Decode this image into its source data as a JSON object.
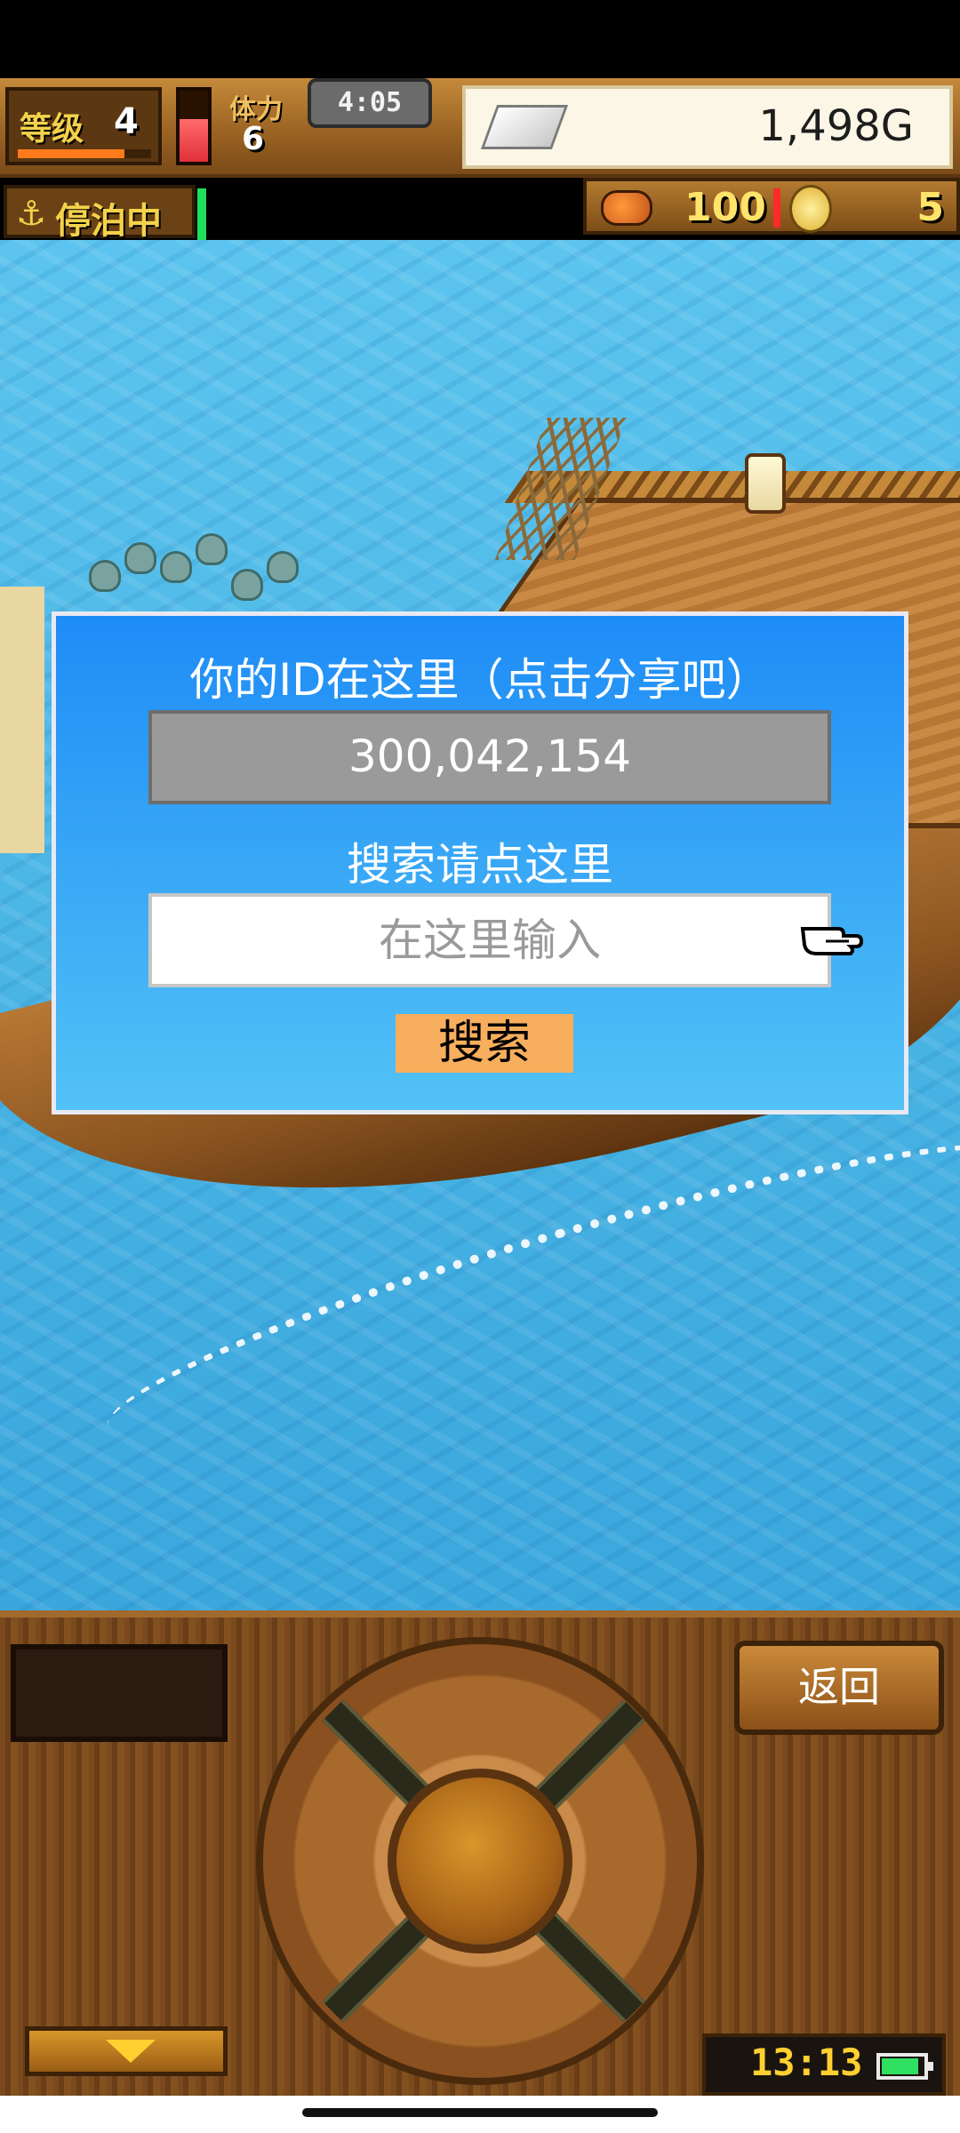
{
  "hud": {
    "level_label": "等级",
    "level_value": "4",
    "level_progress": 0.8,
    "stamina_label": "体力",
    "stamina_value": "6",
    "stamina_level": 0.6,
    "timer": "4:05",
    "gold": "1,498G"
  },
  "status": {
    "anchor_label": "停泊中"
  },
  "resources": {
    "food": "100",
    "coins": "5"
  },
  "dialog": {
    "title": "你的ID在这里（点击分享吧）",
    "user_id": "300,042,154",
    "search_label": "搜索请点这里",
    "search_placeholder": "在这里输入",
    "search_button": "搜索"
  },
  "controls": {
    "back_label": "返回",
    "clock": "13:13",
    "battery_level": 0.9
  },
  "colors": {
    "dialog_top": "#1e8cf6",
    "dialog_bottom": "#52c2f6",
    "search_button": "#f7ae5d",
    "id_box": "#9a9a9a"
  },
  "icons": {
    "anchor": "anchor-icon",
    "gold": "silver-ingot-icon",
    "food": "meat-icon",
    "coin": "coin-icon",
    "pointer": "pointing-hand-icon"
  }
}
